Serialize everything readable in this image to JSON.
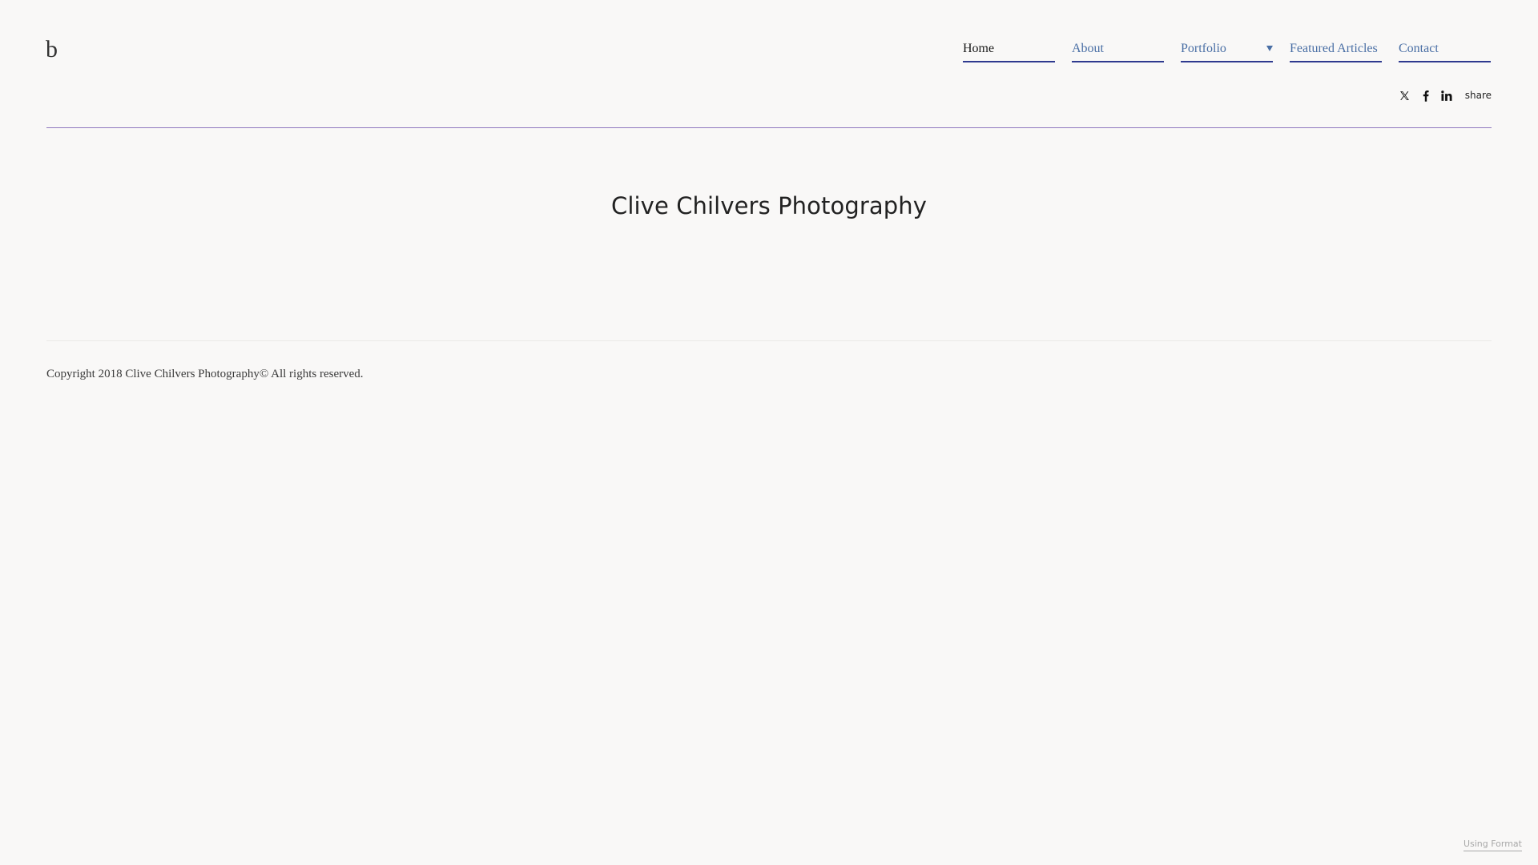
{
  "site": {
    "logo_text": "b"
  },
  "nav": {
    "items": [
      {
        "label": "Home",
        "active": true
      },
      {
        "label": "About"
      },
      {
        "label": "Portfolio",
        "has_dropdown": true
      },
      {
        "label": "Featured Articles"
      },
      {
        "label": "Contact"
      }
    ]
  },
  "social": {
    "icons": [
      "x-twitter-icon",
      "facebook-icon",
      "linkedin-icon"
    ],
    "share_label": "share"
  },
  "main": {
    "title": "Clive Chilvers Photography"
  },
  "footer": {
    "copyright": "Copyright 2018 Clive Chilvers Photography© All rights reserved.",
    "using_format": "Using Format"
  },
  "colors": {
    "background": "#f9f8f7",
    "nav_link": "#4a6fa5",
    "nav_active": "#1a1a1a",
    "nav_underline": "#2f3a8f",
    "header_rule": "#8f79bf",
    "footer_rule": "#ebe9e7"
  }
}
